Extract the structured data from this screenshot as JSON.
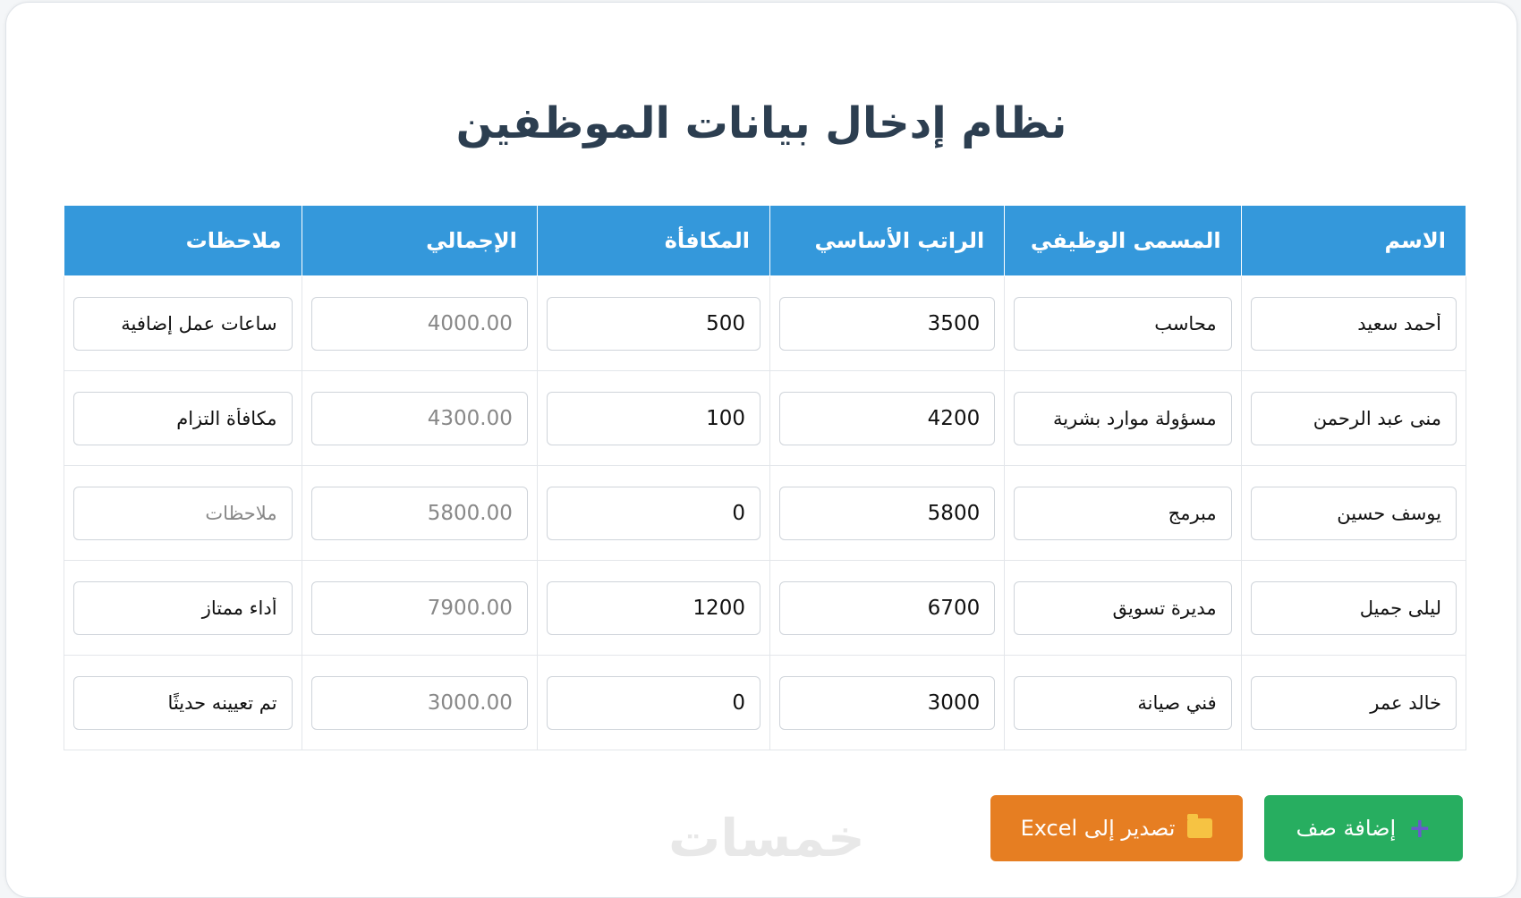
{
  "title": "نظام إدخال بيانات الموظفين",
  "table": {
    "headers": [
      "الاسم",
      "المسمى الوظيفي",
      "الراتب الأساسي",
      "المكافأة",
      "الإجمالي",
      "ملاحظات"
    ],
    "notes_placeholder": "ملاحظات",
    "rows": [
      {
        "name": "أحمد سعيد",
        "job": "محاسب",
        "salary": "3500",
        "bonus": "500",
        "total": "4000.00",
        "notes": "ساعات عمل إضافية"
      },
      {
        "name": "منى عبد الرحمن",
        "job": "مسؤولة موارد بشرية",
        "salary": "4200",
        "bonus": "100",
        "total": "4300.00",
        "notes": "مكافأة التزام"
      },
      {
        "name": "يوسف حسين",
        "job": "مبرمج",
        "salary": "5800",
        "bonus": "0",
        "total": "5800.00",
        "notes": ""
      },
      {
        "name": "ليلى جميل",
        "job": "مديرة تسويق",
        "salary": "6700",
        "bonus": "1200",
        "total": "7900.00",
        "notes": "أداء ممتاز"
      },
      {
        "name": "خالد عمر",
        "job": "فني صيانة",
        "salary": "3000",
        "bonus": "0",
        "total": "3000.00",
        "notes": "تم تعيينه حديثًا"
      }
    ]
  },
  "buttons": {
    "add_row": "إضافة صف",
    "add_row_icon": "plus-icon",
    "export": "تصدير إلى Excel",
    "export_icon": "folder-icon"
  },
  "watermark": "خمسات",
  "colors": {
    "header_bg": "#3498db",
    "add_button": "#27ae60",
    "export_button": "#e67e22",
    "title": "#2c3e50"
  }
}
